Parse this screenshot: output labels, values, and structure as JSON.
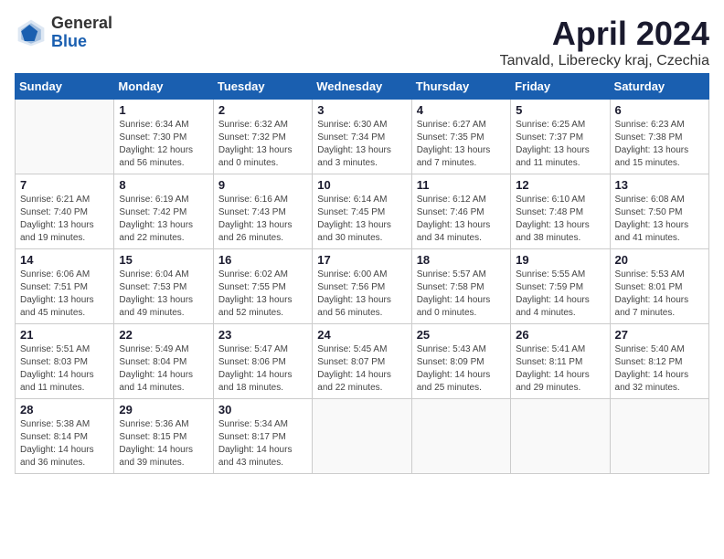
{
  "logo": {
    "general": "General",
    "blue": "Blue"
  },
  "title": "April 2024",
  "subtitle": "Tanvald, Liberecky kraj, Czechia",
  "days_header": [
    "Sunday",
    "Monday",
    "Tuesday",
    "Wednesday",
    "Thursday",
    "Friday",
    "Saturday"
  ],
  "weeks": [
    [
      {
        "num": "",
        "detail": ""
      },
      {
        "num": "1",
        "detail": "Sunrise: 6:34 AM\nSunset: 7:30 PM\nDaylight: 12 hours\nand 56 minutes."
      },
      {
        "num": "2",
        "detail": "Sunrise: 6:32 AM\nSunset: 7:32 PM\nDaylight: 13 hours\nand 0 minutes."
      },
      {
        "num": "3",
        "detail": "Sunrise: 6:30 AM\nSunset: 7:34 PM\nDaylight: 13 hours\nand 3 minutes."
      },
      {
        "num": "4",
        "detail": "Sunrise: 6:27 AM\nSunset: 7:35 PM\nDaylight: 13 hours\nand 7 minutes."
      },
      {
        "num": "5",
        "detail": "Sunrise: 6:25 AM\nSunset: 7:37 PM\nDaylight: 13 hours\nand 11 minutes."
      },
      {
        "num": "6",
        "detail": "Sunrise: 6:23 AM\nSunset: 7:38 PM\nDaylight: 13 hours\nand 15 minutes."
      }
    ],
    [
      {
        "num": "7",
        "detail": "Sunrise: 6:21 AM\nSunset: 7:40 PM\nDaylight: 13 hours\nand 19 minutes."
      },
      {
        "num": "8",
        "detail": "Sunrise: 6:19 AM\nSunset: 7:42 PM\nDaylight: 13 hours\nand 22 minutes."
      },
      {
        "num": "9",
        "detail": "Sunrise: 6:16 AM\nSunset: 7:43 PM\nDaylight: 13 hours\nand 26 minutes."
      },
      {
        "num": "10",
        "detail": "Sunrise: 6:14 AM\nSunset: 7:45 PM\nDaylight: 13 hours\nand 30 minutes."
      },
      {
        "num": "11",
        "detail": "Sunrise: 6:12 AM\nSunset: 7:46 PM\nDaylight: 13 hours\nand 34 minutes."
      },
      {
        "num": "12",
        "detail": "Sunrise: 6:10 AM\nSunset: 7:48 PM\nDaylight: 13 hours\nand 38 minutes."
      },
      {
        "num": "13",
        "detail": "Sunrise: 6:08 AM\nSunset: 7:50 PM\nDaylight: 13 hours\nand 41 minutes."
      }
    ],
    [
      {
        "num": "14",
        "detail": "Sunrise: 6:06 AM\nSunset: 7:51 PM\nDaylight: 13 hours\nand 45 minutes."
      },
      {
        "num": "15",
        "detail": "Sunrise: 6:04 AM\nSunset: 7:53 PM\nDaylight: 13 hours\nand 49 minutes."
      },
      {
        "num": "16",
        "detail": "Sunrise: 6:02 AM\nSunset: 7:55 PM\nDaylight: 13 hours\nand 52 minutes."
      },
      {
        "num": "17",
        "detail": "Sunrise: 6:00 AM\nSunset: 7:56 PM\nDaylight: 13 hours\nand 56 minutes."
      },
      {
        "num": "18",
        "detail": "Sunrise: 5:57 AM\nSunset: 7:58 PM\nDaylight: 14 hours\nand 0 minutes."
      },
      {
        "num": "19",
        "detail": "Sunrise: 5:55 AM\nSunset: 7:59 PM\nDaylight: 14 hours\nand 4 minutes."
      },
      {
        "num": "20",
        "detail": "Sunrise: 5:53 AM\nSunset: 8:01 PM\nDaylight: 14 hours\nand 7 minutes."
      }
    ],
    [
      {
        "num": "21",
        "detail": "Sunrise: 5:51 AM\nSunset: 8:03 PM\nDaylight: 14 hours\nand 11 minutes."
      },
      {
        "num": "22",
        "detail": "Sunrise: 5:49 AM\nSunset: 8:04 PM\nDaylight: 14 hours\nand 14 minutes."
      },
      {
        "num": "23",
        "detail": "Sunrise: 5:47 AM\nSunset: 8:06 PM\nDaylight: 14 hours\nand 18 minutes."
      },
      {
        "num": "24",
        "detail": "Sunrise: 5:45 AM\nSunset: 8:07 PM\nDaylight: 14 hours\nand 22 minutes."
      },
      {
        "num": "25",
        "detail": "Sunrise: 5:43 AM\nSunset: 8:09 PM\nDaylight: 14 hours\nand 25 minutes."
      },
      {
        "num": "26",
        "detail": "Sunrise: 5:41 AM\nSunset: 8:11 PM\nDaylight: 14 hours\nand 29 minutes."
      },
      {
        "num": "27",
        "detail": "Sunrise: 5:40 AM\nSunset: 8:12 PM\nDaylight: 14 hours\nand 32 minutes."
      }
    ],
    [
      {
        "num": "28",
        "detail": "Sunrise: 5:38 AM\nSunset: 8:14 PM\nDaylight: 14 hours\nand 36 minutes."
      },
      {
        "num": "29",
        "detail": "Sunrise: 5:36 AM\nSunset: 8:15 PM\nDaylight: 14 hours\nand 39 minutes."
      },
      {
        "num": "30",
        "detail": "Sunrise: 5:34 AM\nSunset: 8:17 PM\nDaylight: 14 hours\nand 43 minutes."
      },
      {
        "num": "",
        "detail": ""
      },
      {
        "num": "",
        "detail": ""
      },
      {
        "num": "",
        "detail": ""
      },
      {
        "num": "",
        "detail": ""
      }
    ]
  ]
}
